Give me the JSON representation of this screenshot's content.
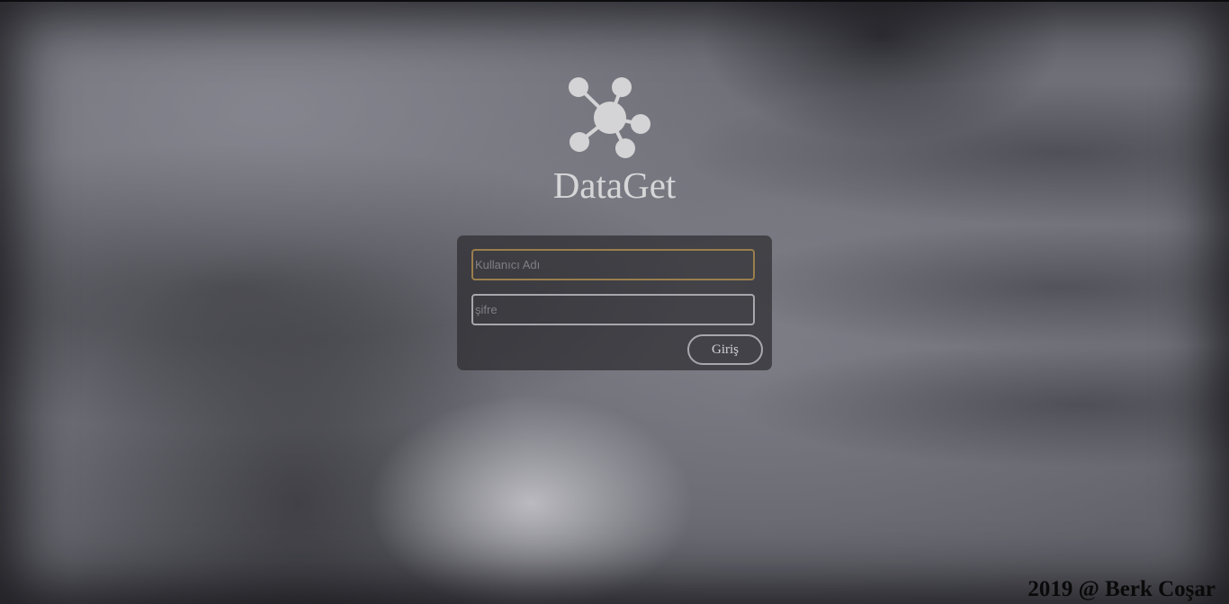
{
  "app": {
    "name": "DataGet",
    "logo_icon": "molecule-network-icon"
  },
  "login_form": {
    "username": {
      "value": "",
      "placeholder": "Kullanıcı Adı"
    },
    "password": {
      "value": "",
      "placeholder": "şifre"
    },
    "submit_label": "Giriş"
  },
  "footer": {
    "text": "2019 @ Berk Coşar"
  },
  "colors": {
    "brand_text": "#d6d6d8",
    "focused_border": "#9a7e4c",
    "input_border": "#a7a7ac",
    "panel_background": "#2d2d30"
  }
}
